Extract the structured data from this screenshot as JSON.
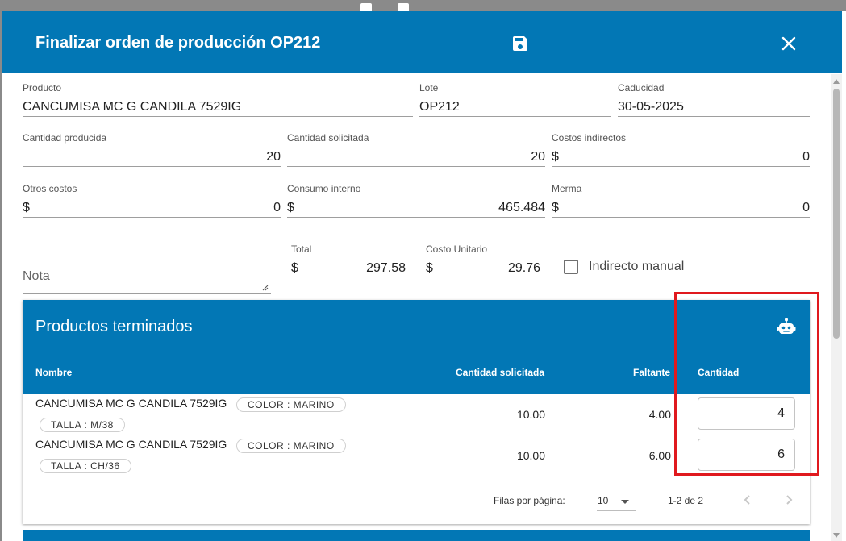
{
  "dialog": {
    "title": "Finalizar orden de producción OP212",
    "save_icon": "save-icon",
    "close_icon": "close-icon"
  },
  "form": {
    "producto": {
      "label": "Producto",
      "value": "CANCUMISA MC G CANDILA 7529IG"
    },
    "lote": {
      "label": "Lote",
      "value": "OP212"
    },
    "caducidad": {
      "label": "Caducidad",
      "value": "30-05-2025"
    },
    "cantidad_producida": {
      "label": "Cantidad producida",
      "value": "20"
    },
    "cantidad_solicitada": {
      "label": "Cantidad solicitada",
      "value": "20"
    },
    "costos_indirectos": {
      "label": "Costos indirectos",
      "prefix": "$",
      "value": "0"
    },
    "otros_costos": {
      "label": "Otros costos",
      "prefix": "$",
      "value": "0"
    },
    "consumo_interno": {
      "label": "Consumo interno",
      "prefix": "$",
      "value": "465.484"
    },
    "merma": {
      "label": "Merma",
      "prefix": "$",
      "value": "0"
    },
    "nota": {
      "placeholder": "Nota"
    },
    "total": {
      "label": "Total",
      "prefix": "$",
      "value": "297.58"
    },
    "costo_unitario": {
      "label": "Costo Unitario",
      "prefix": "$",
      "value": "29.76"
    },
    "indirecto_manual": {
      "label": "Indirecto manual",
      "checked": false
    }
  },
  "table": {
    "title": "Productos terminados",
    "action_icon": "robot-icon",
    "columns": [
      "Nombre",
      "Cantidad solicitada",
      "Faltante",
      "Cantidad"
    ],
    "rows": [
      {
        "nombre": "CANCUMISA MC G CANDILA 7529IG",
        "chips": [
          "COLOR : MARINO",
          "TALLA : M/38"
        ],
        "cantidad_solicitada": "10.00",
        "faltante": "4.00",
        "cantidad": "4"
      },
      {
        "nombre": "CANCUMISA MC G CANDILA 7529IG",
        "chips": [
          "COLOR : MARINO",
          "TALLA : CH/36"
        ],
        "cantidad_solicitada": "10.00",
        "faltante": "6.00",
        "cantidad": "6"
      }
    ],
    "pagination": {
      "rows_per_page_label": "Filas por página:",
      "rows_per_page": "10",
      "range": "1-2 de 2"
    }
  },
  "colors": {
    "primary": "#0277b5",
    "highlight": "#e0191e"
  }
}
